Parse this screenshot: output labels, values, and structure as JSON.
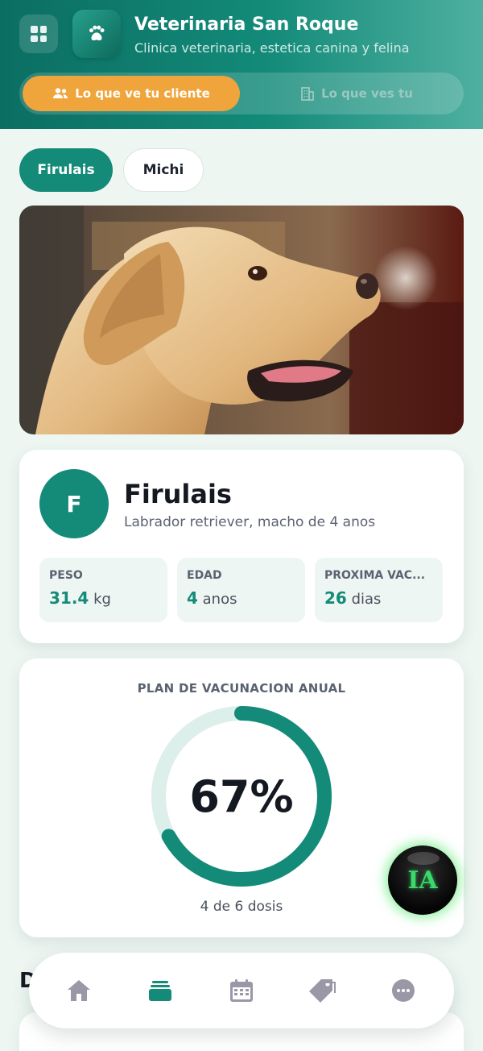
{
  "header": {
    "app_title": "Veterinaria San Roque",
    "app_subtitle": "Clinica veterinaria, estetica canina y felina",
    "menu_icon": "grid-icon",
    "logo_icon": "paw-icon",
    "view_toggle": {
      "client_label": "Lo que ve tu cliente",
      "client_icon": "users-icon",
      "you_label": "Lo que ves tu",
      "you_icon": "building-icon"
    }
  },
  "pet_tabs": [
    {
      "label": "Firulais",
      "active": true
    },
    {
      "label": "Michi",
      "active": false
    }
  ],
  "profile": {
    "avatar_initial": "F",
    "name": "Firulais",
    "description": "Labrador retriever, macho de 4 anos",
    "stats": [
      {
        "label": "PESO",
        "value": "31.4",
        "unit": "kg"
      },
      {
        "label": "EDAD",
        "value": "4",
        "unit": "anos"
      },
      {
        "label": "PROXIMA VAC...",
        "value": "26",
        "unit": "dias"
      }
    ]
  },
  "vaccination": {
    "title": "PLAN DE VACUNACION ANUAL",
    "percent_label": "67%",
    "progress": 0.67,
    "doses_label": "4 de 6 dosis"
  },
  "next_section_heading": "D",
  "ia_button": {
    "label": "IA"
  },
  "bottom_nav": [
    {
      "icon": "home-icon",
      "active": false
    },
    {
      "icon": "cards-icon",
      "active": true
    },
    {
      "icon": "calendar-icon",
      "active": false
    },
    {
      "icon": "tag-icon",
      "active": false
    },
    {
      "icon": "more-icon",
      "active": false
    }
  ],
  "colors": {
    "primary": "#148a78",
    "accent": "#f0a43c",
    "ring_track": "#dcefeb",
    "ia_glow": "#39d96a",
    "nav_inactive": "#9a98a6"
  }
}
